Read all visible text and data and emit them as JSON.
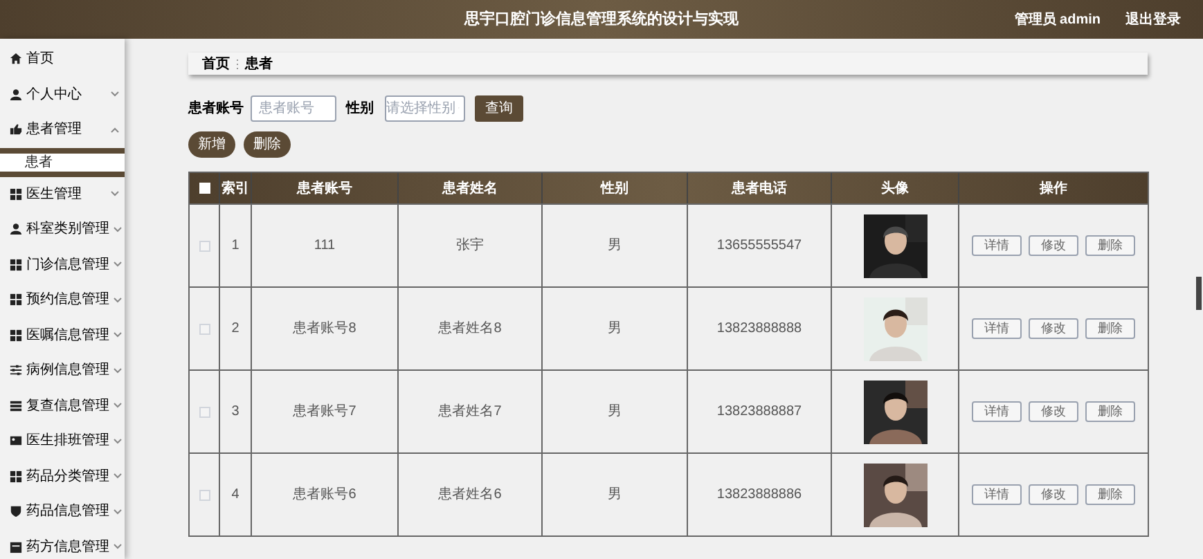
{
  "header": {
    "title": "思宇口腔门诊信息管理系统的设计与实现",
    "user": "管理员 admin",
    "logout": "退出登录"
  },
  "sidebar": {
    "items": [
      {
        "kind": "link",
        "label": "首页"
      },
      {
        "kind": "menu",
        "label": "个人中心",
        "expanded": false
      },
      {
        "kind": "menu",
        "label": "患者管理",
        "expanded": true,
        "children": [
          {
            "label": "患者",
            "selected": true
          }
        ]
      },
      {
        "kind": "menu",
        "label": "医生管理",
        "expanded": false
      },
      {
        "kind": "menu",
        "label": "科室类别管理",
        "expanded": false
      },
      {
        "kind": "menu",
        "label": "门诊信息管理",
        "expanded": false
      },
      {
        "kind": "menu",
        "label": "预约信息管理",
        "expanded": false
      },
      {
        "kind": "menu",
        "label": "医嘱信息管理",
        "expanded": false
      },
      {
        "kind": "menu",
        "label": "病例信息管理",
        "expanded": false
      },
      {
        "kind": "menu",
        "label": "复查信息管理",
        "expanded": false
      },
      {
        "kind": "menu",
        "label": "医生排班管理",
        "expanded": false
      },
      {
        "kind": "menu",
        "label": "药品分类管理",
        "expanded": false
      },
      {
        "kind": "menu",
        "label": "药品信息管理",
        "expanded": false
      },
      {
        "kind": "menu",
        "label": "药方信息管理",
        "expanded": false
      }
    ]
  },
  "breadcrumb": [
    "首页",
    "患者"
  ],
  "search": {
    "account_label": "患者账号",
    "account_placeholder": "患者账号",
    "gender_label": "性别",
    "gender_placeholder": "请选择性别",
    "query_button": "查询"
  },
  "actions": [
    "新增",
    "删除"
  ],
  "table": {
    "all_checked": false,
    "columns": [
      "索引",
      "患者账号",
      "患者姓名",
      "性别",
      "患者电话",
      "头像",
      "操作"
    ],
    "rows": [
      {
        "checked": false,
        "index": "1",
        "account": "111",
        "name": "张宇",
        "gender": "男",
        "phone": "13655555547",
        "avatar": {
          "kind": "picture"
        },
        "ops": [
          "详情",
          "修改",
          "删除"
        ]
      },
      {
        "checked": false,
        "index": "2",
        "account": "患者账号8",
        "name": "患者姓名8",
        "gender": "男",
        "phone": "13823888888",
        "avatar": {
          "kind": "picture"
        },
        "ops": [
          "详情",
          "修改",
          "删除"
        ]
      },
      {
        "checked": false,
        "index": "3",
        "account": "患者账号7",
        "name": "患者姓名7",
        "gender": "男",
        "phone": "13823888887",
        "avatar": {
          "kind": "picture"
        },
        "ops": [
          "详情",
          "修改",
          "删除"
        ]
      },
      {
        "checked": false,
        "index": "4",
        "account": "患者账号6",
        "name": "患者姓名6",
        "gender": "男",
        "phone": "13823888886",
        "avatar": {
          "kind": "picture"
        },
        "ops": [
          "详情",
          "修改",
          "删除"
        ]
      }
    ]
  }
}
